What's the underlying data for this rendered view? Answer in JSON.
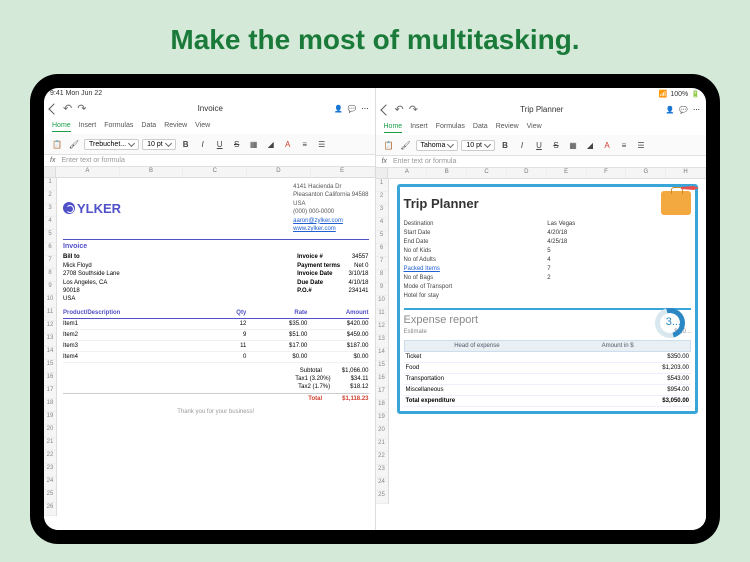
{
  "headline": "Make the most of multitasking.",
  "status": {
    "time": "9:41",
    "date": "Mon Jun 22",
    "battery": "100%"
  },
  "left": {
    "doc_title": "Invoice",
    "tabs": [
      "Home",
      "Insert",
      "Formulas",
      "Data",
      "Review",
      "View"
    ],
    "font": "Trebuchet...",
    "size": "10 pt",
    "fx_placeholder": "Enter text or formula",
    "cols": [
      "A",
      "B",
      "C",
      "D",
      "E"
    ],
    "rows": [
      "1",
      "2",
      "3",
      "4",
      "5",
      "6",
      "7",
      "8",
      "9",
      "10",
      "11",
      "12",
      "13",
      "14",
      "15",
      "16",
      "17",
      "18",
      "19",
      "20",
      "21",
      "22",
      "23",
      "24",
      "25",
      "26"
    ],
    "company": "YLKER",
    "address": [
      "4141 Hacienda Dr",
      "Pleasanton California 94588",
      "USA",
      "(000) 000-0000"
    ],
    "email": "aaron@zylker.com",
    "website": "www.zylker.com",
    "invoice_heading": "Invoice",
    "bill_to_label": "Bill to",
    "bill_to": [
      "Mick Floyd",
      "2708 Southside Lane",
      "Los Angeles, CA",
      "90018",
      "USA"
    ],
    "meta": [
      {
        "k": "Invoice #",
        "v": "34557"
      },
      {
        "k": "Payment terms",
        "v": "Net 0"
      },
      {
        "k": "Invoice Date",
        "v": "3/10/18"
      },
      {
        "k": "Due Date",
        "v": "4/10/18"
      },
      {
        "k": "P.O.#",
        "v": "234141"
      }
    ],
    "item_headers": [
      "Product/Description",
      "Qty",
      "Rate",
      "Amount"
    ],
    "items": [
      {
        "d": "Item1",
        "q": "12",
        "r": "$35.00",
        "a": "$420.00"
      },
      {
        "d": "Item2",
        "q": "9",
        "r": "$51.00",
        "a": "$459.00"
      },
      {
        "d": "Item3",
        "q": "11",
        "r": "$17.00",
        "a": "$187.00"
      },
      {
        "d": "Item4",
        "q": "0",
        "r": "$0.00",
        "a": "$0.00"
      }
    ],
    "totals": [
      {
        "k": "Subtotal",
        "v": "$1,066.00"
      },
      {
        "k": "Tax1 (3.20%)",
        "v": "$34.11"
      },
      {
        "k": "Tax2 (1.7%)",
        "v": "$18.12"
      }
    ],
    "total_label": "Total",
    "total": "$1,118.23",
    "thanks": "Thank you for your business!"
  },
  "right": {
    "doc_title": "Trip Planner",
    "tabs": [
      "Home",
      "Insert",
      "Formulas",
      "Data",
      "Review",
      "View"
    ],
    "font": "Tahoma",
    "size": "10 pt",
    "fx_placeholder": "Enter text or formula",
    "cols": [
      "A",
      "B",
      "C",
      "D",
      "E",
      "F",
      "G",
      "H"
    ],
    "rows": [
      "1",
      "2",
      "3",
      "4",
      "5",
      "6",
      "7",
      "8",
      "9",
      "10",
      "11",
      "12",
      "13",
      "14",
      "15",
      "16",
      "17",
      "18",
      "19",
      "20",
      "21",
      "22",
      "23",
      "24",
      "25"
    ],
    "trip_title": "Trip Planner",
    "fields": [
      {
        "k": "Destination",
        "v": "Las Vegas"
      },
      {
        "k": "Start Date",
        "v": "4/20/18"
      },
      {
        "k": "End Date",
        "v": "4/25/18"
      },
      {
        "k": "No of Kids",
        "v": "5"
      },
      {
        "k": "No of Adults",
        "v": "4"
      },
      {
        "k": "Packed Items",
        "v": "7",
        "link": true
      },
      {
        "k": "No of Bags",
        "v": "2"
      },
      {
        "k": "Mode of Transport",
        "v": ""
      },
      {
        "k": "Hotel for stay",
        "v": ""
      }
    ],
    "expense_title": "Expense report",
    "ring_text": "3...",
    "estimate_label": "Estimate",
    "estimate_value": "$4,0...",
    "exp_headers": [
      "Head of expense",
      "Amount in $"
    ],
    "expenses": [
      {
        "k": "Ticket",
        "v": "$350.00"
      },
      {
        "k": "Food",
        "v": "$1,203.00"
      },
      {
        "k": "Transportation",
        "v": "$543.00"
      },
      {
        "k": "Miscellaneous",
        "v": "$954.00"
      }
    ],
    "exp_total_label": "Total expenditure",
    "exp_total": "$3,050.00"
  }
}
